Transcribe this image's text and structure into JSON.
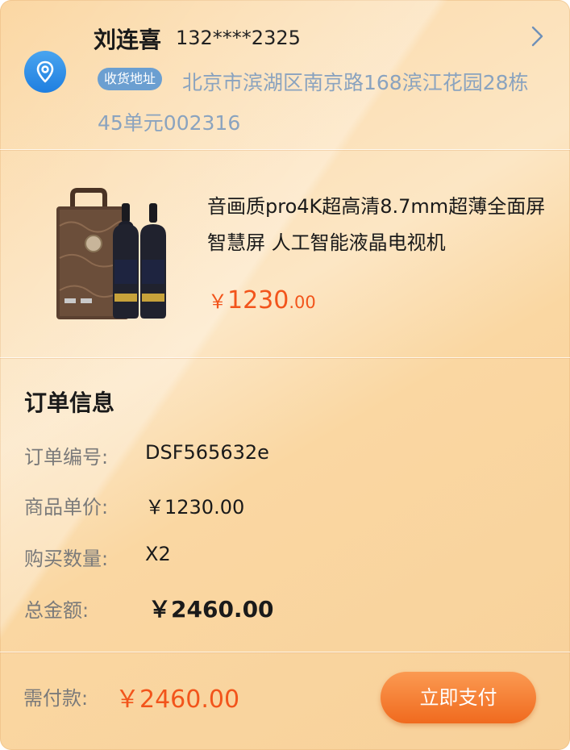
{
  "address": {
    "name": "刘连喜",
    "phone": "132****2325",
    "tag": "收货地址",
    "line": "北京市滨湖区南京路168滨江花园28栋45单元002316",
    "icon": "location-pin-icon",
    "action_icon": "chevron-right-icon"
  },
  "product": {
    "image": "wine-gift-box-image",
    "title": "音画质pro4K超高清8.7mm超薄全面屏 智慧屏 人工智能液晶电视机",
    "price_symbol": "￥",
    "price_int": "1230",
    "price_dec": ".00"
  },
  "order_info": {
    "title": "订单信息",
    "rows": [
      {
        "label": "订单编号:",
        "value": "DSF565632e"
      },
      {
        "label": "商品单价:",
        "value": "￥1230.00"
      },
      {
        "label": "购买数量:",
        "value": "X2"
      },
      {
        "label": "总金额:",
        "value": "￥2460.00"
      }
    ]
  },
  "footer": {
    "pay_label": "需付款:",
    "pay_value": "￥2460.00",
    "pay_button": "立即支付"
  },
  "colors": {
    "accent": "#f2541b",
    "tag_bg": "#6b9fd1",
    "location_icon": "#2a88e6"
  }
}
